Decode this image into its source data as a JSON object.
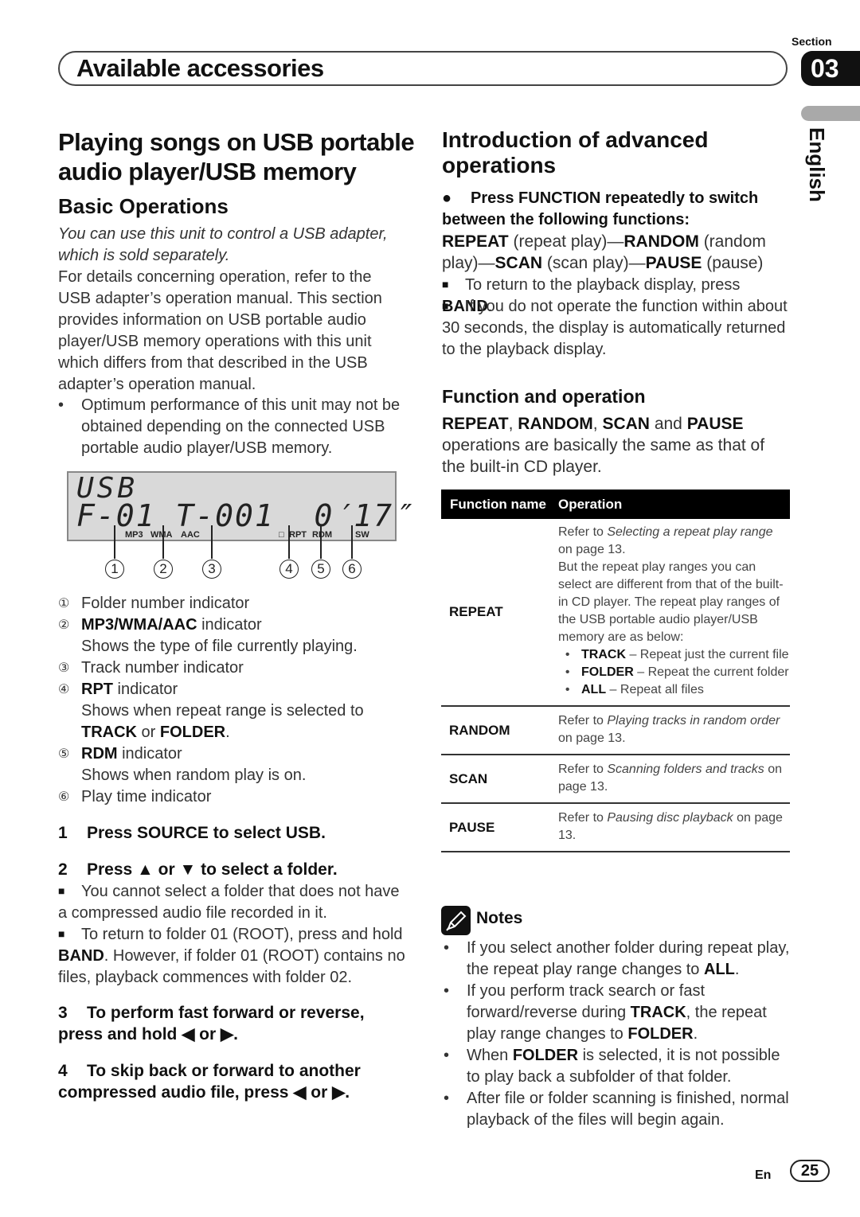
{
  "header": {
    "title": "Available accessories",
    "section_label": "Section",
    "section_number": "03",
    "language_tab": "English"
  },
  "left": {
    "title": "Playing songs on USB portable audio player/USB memory",
    "subtitle": "Basic Operations",
    "intro_italic": "You can use this unit to control a USB adapter, which is sold separately.",
    "intro_body": "For details concerning operation, refer to the USB adapter’s operation manual. This section provides information on USB portable audio player/USB memory operations with this unit which differs from that described in the USB adapter’s operation manual.",
    "bullet": "Optimum performance of this unit may not be obtained depending on the connected USB portable audio player/USB memory.",
    "bullet_mark": "•",
    "display": {
      "line1": "USB",
      "line2": "F-01 T-001  0′17″",
      "labels": {
        "mp3": "MP3",
        "wma": "WMA",
        "aac": "AAC",
        "rpt": "RPT",
        "rdm": "RDM",
        "sw": "SW"
      },
      "callouts": [
        "1",
        "2",
        "3",
        "4",
        "5",
        "6"
      ]
    },
    "legend": [
      {
        "num": "①",
        "bold": "",
        "text": "Folder number indicator",
        "sub": ""
      },
      {
        "num": "②",
        "bold": "MP3/WMA/AAC",
        "text": " indicator",
        "sub": "Shows the type of file currently playing."
      },
      {
        "num": "③",
        "bold": "",
        "text": "Track number indicator",
        "sub": ""
      },
      {
        "num": "④",
        "bold": "RPT",
        "text": " indicator",
        "sub": "Shows when repeat range is selected to",
        "sub2_bold1": "TRACK",
        "sub2_mid": " or ",
        "sub2_bold2": "FOLDER",
        "sub2_end": "."
      },
      {
        "num": "⑤",
        "bold": "RDM",
        "text": " indicator",
        "sub": "Shows when random play is on."
      },
      {
        "num": "⑥",
        "bold": "",
        "text": "Play time indicator",
        "sub": ""
      }
    ],
    "steps": [
      {
        "num": "1",
        "text": "Press SOURCE to select USB."
      },
      {
        "num": "2",
        "text": "Press ▲ or ▼ to select a folder."
      },
      {
        "num": "3",
        "text": "To perform fast forward or reverse, press and hold ◀ or ▶."
      },
      {
        "num": "4",
        "text": "To skip back or forward to another compressed audio file, press ◀ or ▶."
      }
    ],
    "step2_notes": {
      "mark": "■",
      "note1": "You cannot select a folder that does not have a compressed audio file recorded in it.",
      "note2_pre": "To return to folder 01 (ROOT), press and hold ",
      "note2_bold": "BAND",
      "note2_post": ". However, if folder 01 (ROOT) contains no files, playback commences with folder 02."
    }
  },
  "right": {
    "title": "Introduction of advanced operations",
    "instruction_mark": "●",
    "instruction": "Press FUNCTION repeatedly to switch between the following functions:",
    "sequence": {
      "f1": "REPEAT",
      "d1": " (repeat play)—",
      "f2": "RANDOM",
      "d2": " (random play)—",
      "f3": "SCAN",
      "d3": " (scan play)—",
      "f4": "PAUSE",
      "d4": " (pause)"
    },
    "note_mark": "■",
    "note1_pre": "To return to the playback display, press ",
    "note1_bold": "BAND",
    "note1_post": ".",
    "note2": "If you do not operate the function within about 30 seconds, the display is automatically returned to the playback display.",
    "subtitle": "Function and operation",
    "func_intro": {
      "b1": "REPEAT",
      "s1": ", ",
      "b2": "RANDOM",
      "s2": ", ",
      "b3": "SCAN",
      "s3": " and ",
      "b4": "PAUSE",
      "rest": " operations are basically the same as that of the built-in CD player."
    },
    "table": {
      "headers": [
        "Function name",
        "Operation"
      ],
      "rows": [
        {
          "name": "REPEAT",
          "pre": "Refer to ",
          "ital": "Selecting a repeat play range",
          "post": " on page 13.",
          "extra": "But the repeat play ranges you can select are different from that of the built-in CD player. The repeat play ranges of the USB portable audio player/USB memory are as below:",
          "bullets": [
            {
              "bold": "TRACK",
              "text": " – Repeat just the current file"
            },
            {
              "bold": "FOLDER",
              "text": " – Repeat the current folder"
            },
            {
              "bold": "ALL",
              "text": " – Repeat all files"
            }
          ]
        },
        {
          "name": "RANDOM",
          "pre": "Refer to ",
          "ital": "Playing tracks in random order",
          "post": " on page 13."
        },
        {
          "name": "SCAN",
          "pre": "Refer to ",
          "ital": "Scanning folders and tracks",
          "post": " on page 13."
        },
        {
          "name": "PAUSE",
          "pre": "Refer to ",
          "ital": "Pausing disc playback",
          "post": " on page 13."
        }
      ]
    },
    "notes": {
      "title": "Notes",
      "items": [
        {
          "pre": "If you select another folder during repeat play, the repeat play range changes to ",
          "bold": "ALL",
          "post": ".",
          "bold2": "",
          "post2": ""
        },
        {
          "pre": "If you perform track search or fast forward/reverse during ",
          "bold": "TRACK",
          "post": ", the repeat play range changes to ",
          "bold2": "FOLDER",
          "post2": "."
        },
        {
          "pre": "When ",
          "bold": "FOLDER",
          "post": " is selected, it is not possible to play back a subfolder of that folder.",
          "bold2": "",
          "post2": ""
        },
        {
          "pre": "After file or folder scanning is finished, normal playback of the files will begin again.",
          "bold": "",
          "post": "",
          "bold2": "",
          "post2": ""
        }
      ]
    }
  },
  "footer": {
    "lang": "En",
    "page": "25"
  }
}
